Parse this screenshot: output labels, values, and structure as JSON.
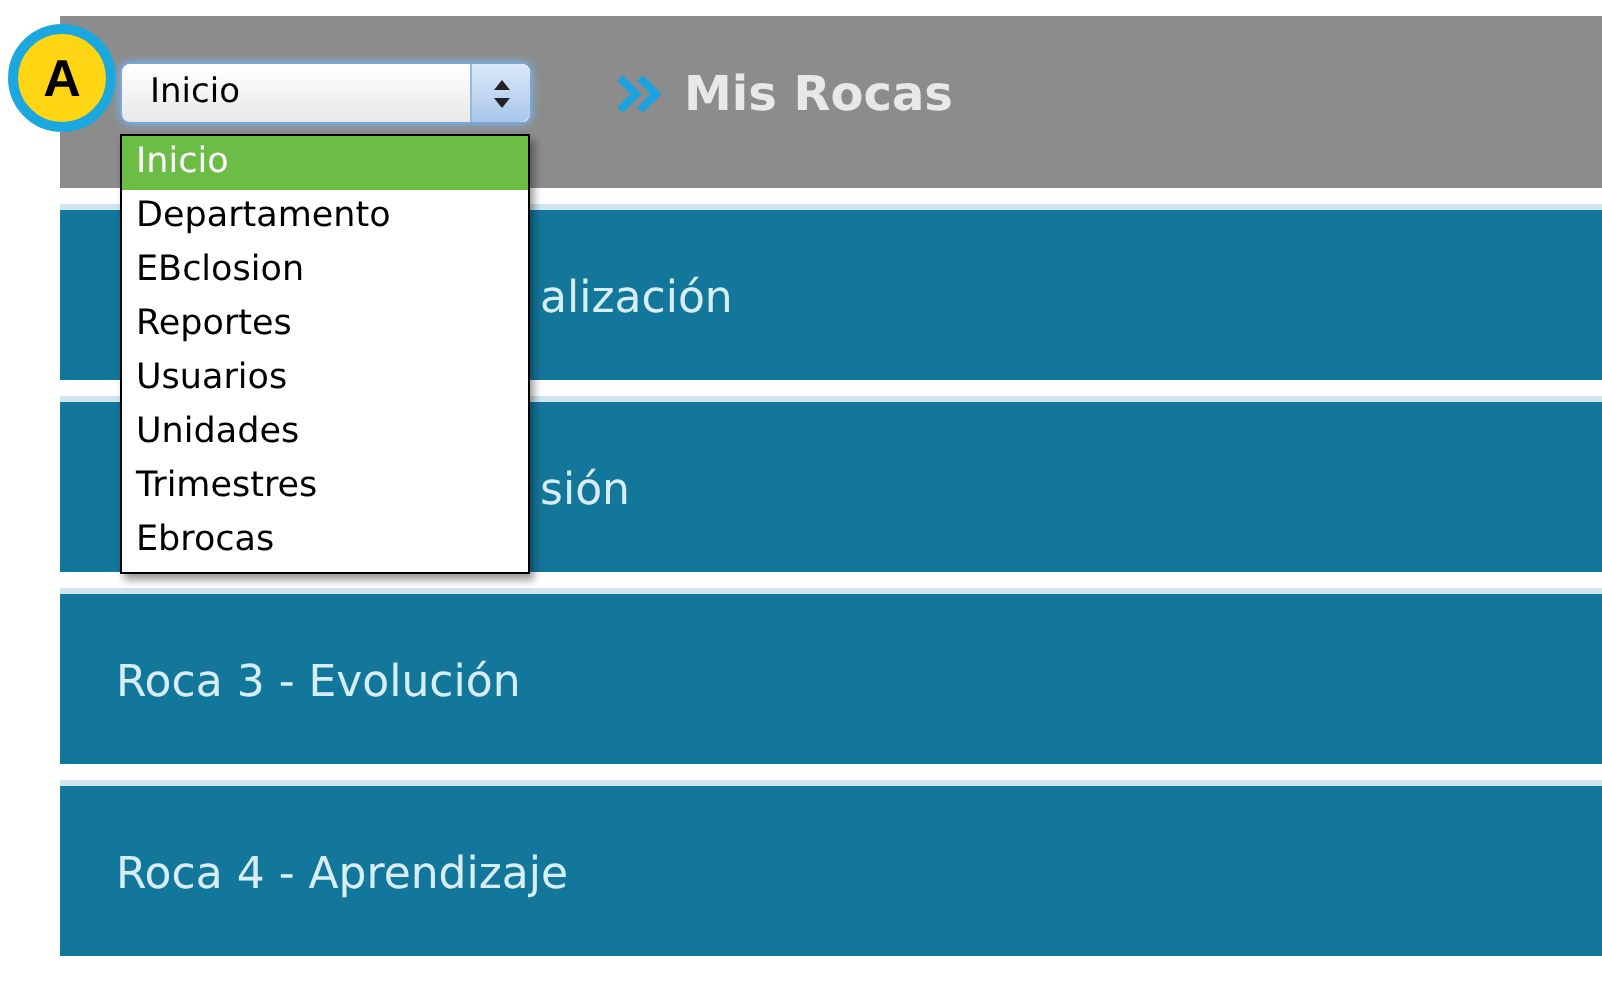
{
  "badge": {
    "label": "A"
  },
  "select": {
    "value": "Inicio",
    "options": [
      {
        "label": "Inicio",
        "selected": true
      },
      {
        "label": "Departamento",
        "selected": false
      },
      {
        "label": "EBclosion",
        "selected": false
      },
      {
        "label": "Reportes",
        "selected": false
      },
      {
        "label": "Usuarios",
        "selected": false
      },
      {
        "label": "Unidades",
        "selected": false
      },
      {
        "label": "Trimestres",
        "selected": false
      },
      {
        "label": "Ebrocas",
        "selected": false
      }
    ]
  },
  "header": {
    "title": "Mis Rocas"
  },
  "rows": [
    {
      "kind": "covered",
      "label": "alización"
    },
    {
      "kind": "covered",
      "label": "sión"
    },
    {
      "kind": "plain",
      "label": "Roca 3 - Evolución"
    },
    {
      "kind": "plain",
      "label": "Roca 4 - Aprendizaje"
    }
  ]
}
